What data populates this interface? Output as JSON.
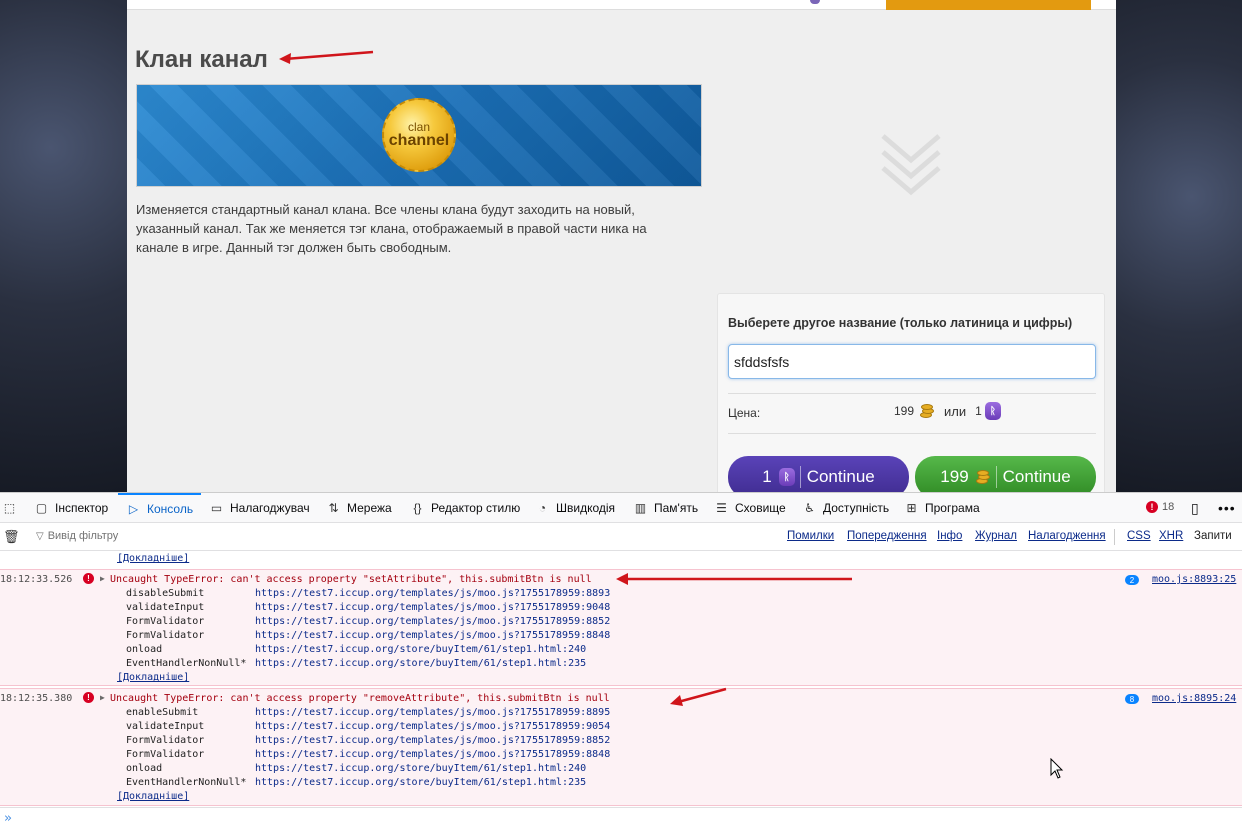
{
  "page": {
    "title": "Клан канал",
    "banner": {
      "coin_sub": "clan",
      "coin_main": "channel"
    },
    "description": "Изменяется стандартный канал клана. Все члены клана будут заходить на новый, указанный канал. Так же меняется тэг клана, отображаемый в правой части ника на канале в игре. Данный тэг должен быть свободным.",
    "form": {
      "label": "Выберете другое название (только латиница и цифры)",
      "input_value": "sfddsfsfs",
      "price_label": "Цена:",
      "price_gold": "199",
      "or_text": "или",
      "price_rune": "1",
      "btn_rune_amount": "1",
      "btn_rune_label": "Continue",
      "btn_gold_amount": "199",
      "btn_gold_label": "Continue"
    }
  },
  "devtools": {
    "tabs": [
      "Інспектор",
      "Консоль",
      "Налагоджувач",
      "Мережа",
      "Редактор стилю",
      "Швидкодія",
      "Пам'ять",
      "Сховище",
      "Доступність",
      "Програма"
    ],
    "active_tab": "Консоль",
    "error_count": "18",
    "filter_placeholder": "Вивід фільтру",
    "filter_buttons": [
      "Помилки",
      "Попередження",
      "Інфо",
      "Журнал",
      "Налагодження",
      "CSS",
      "XHR",
      "Запити"
    ],
    "more_link": "[Докладніше]",
    "errors": [
      {
        "time": "18:12:33.526",
        "message": "Uncaught TypeError: can't access property \"setAttribute\", this.submitBtn is null",
        "repeat": "2",
        "location": "moo.js:8893:25",
        "stack": [
          {
            "fn": "disableSubmit",
            "url": "https://test7.iccup.org/templates/js/moo.js?1755178959:8893"
          },
          {
            "fn": "validateInput",
            "url": "https://test7.iccup.org/templates/js/moo.js?1755178959:9048"
          },
          {
            "fn": "FormValidator",
            "url": "https://test7.iccup.org/templates/js/moo.js?1755178959:8852"
          },
          {
            "fn": "FormValidator",
            "url": "https://test7.iccup.org/templates/js/moo.js?1755178959:8848"
          },
          {
            "fn": "onload",
            "url": "https://test7.iccup.org/store/buyItem/61/step1.html:240"
          },
          {
            "fn": "EventHandlerNonNull*",
            "url": "https://test7.iccup.org/store/buyItem/61/step1.html:235"
          }
        ]
      },
      {
        "time": "18:12:35.380",
        "message": "Uncaught TypeError: can't access property \"removeAttribute\", this.submitBtn is null",
        "repeat": "8",
        "location": "moo.js:8895:24",
        "stack": [
          {
            "fn": "enableSubmit",
            "url": "https://test7.iccup.org/templates/js/moo.js?1755178959:8895"
          },
          {
            "fn": "validateInput",
            "url": "https://test7.iccup.org/templates/js/moo.js?1755178959:9054"
          },
          {
            "fn": "FormValidator",
            "url": "https://test7.iccup.org/templates/js/moo.js?1755178959:8852"
          },
          {
            "fn": "FormValidator",
            "url": "https://test7.iccup.org/templates/js/moo.js?1755178959:8848"
          },
          {
            "fn": "onload",
            "url": "https://test7.iccup.org/store/buyItem/61/step1.html:240"
          },
          {
            "fn": "EventHandlerNonNull*",
            "url": "https://test7.iccup.org/store/buyItem/61/step1.html:235"
          }
        ]
      }
    ]
  },
  "colors": {
    "accent": "#0a84ff",
    "error": "#a4000f",
    "annotation_arrow": "#d0151b",
    "gold_button": "#3c9a30",
    "rune_button": "#4a36a0"
  }
}
